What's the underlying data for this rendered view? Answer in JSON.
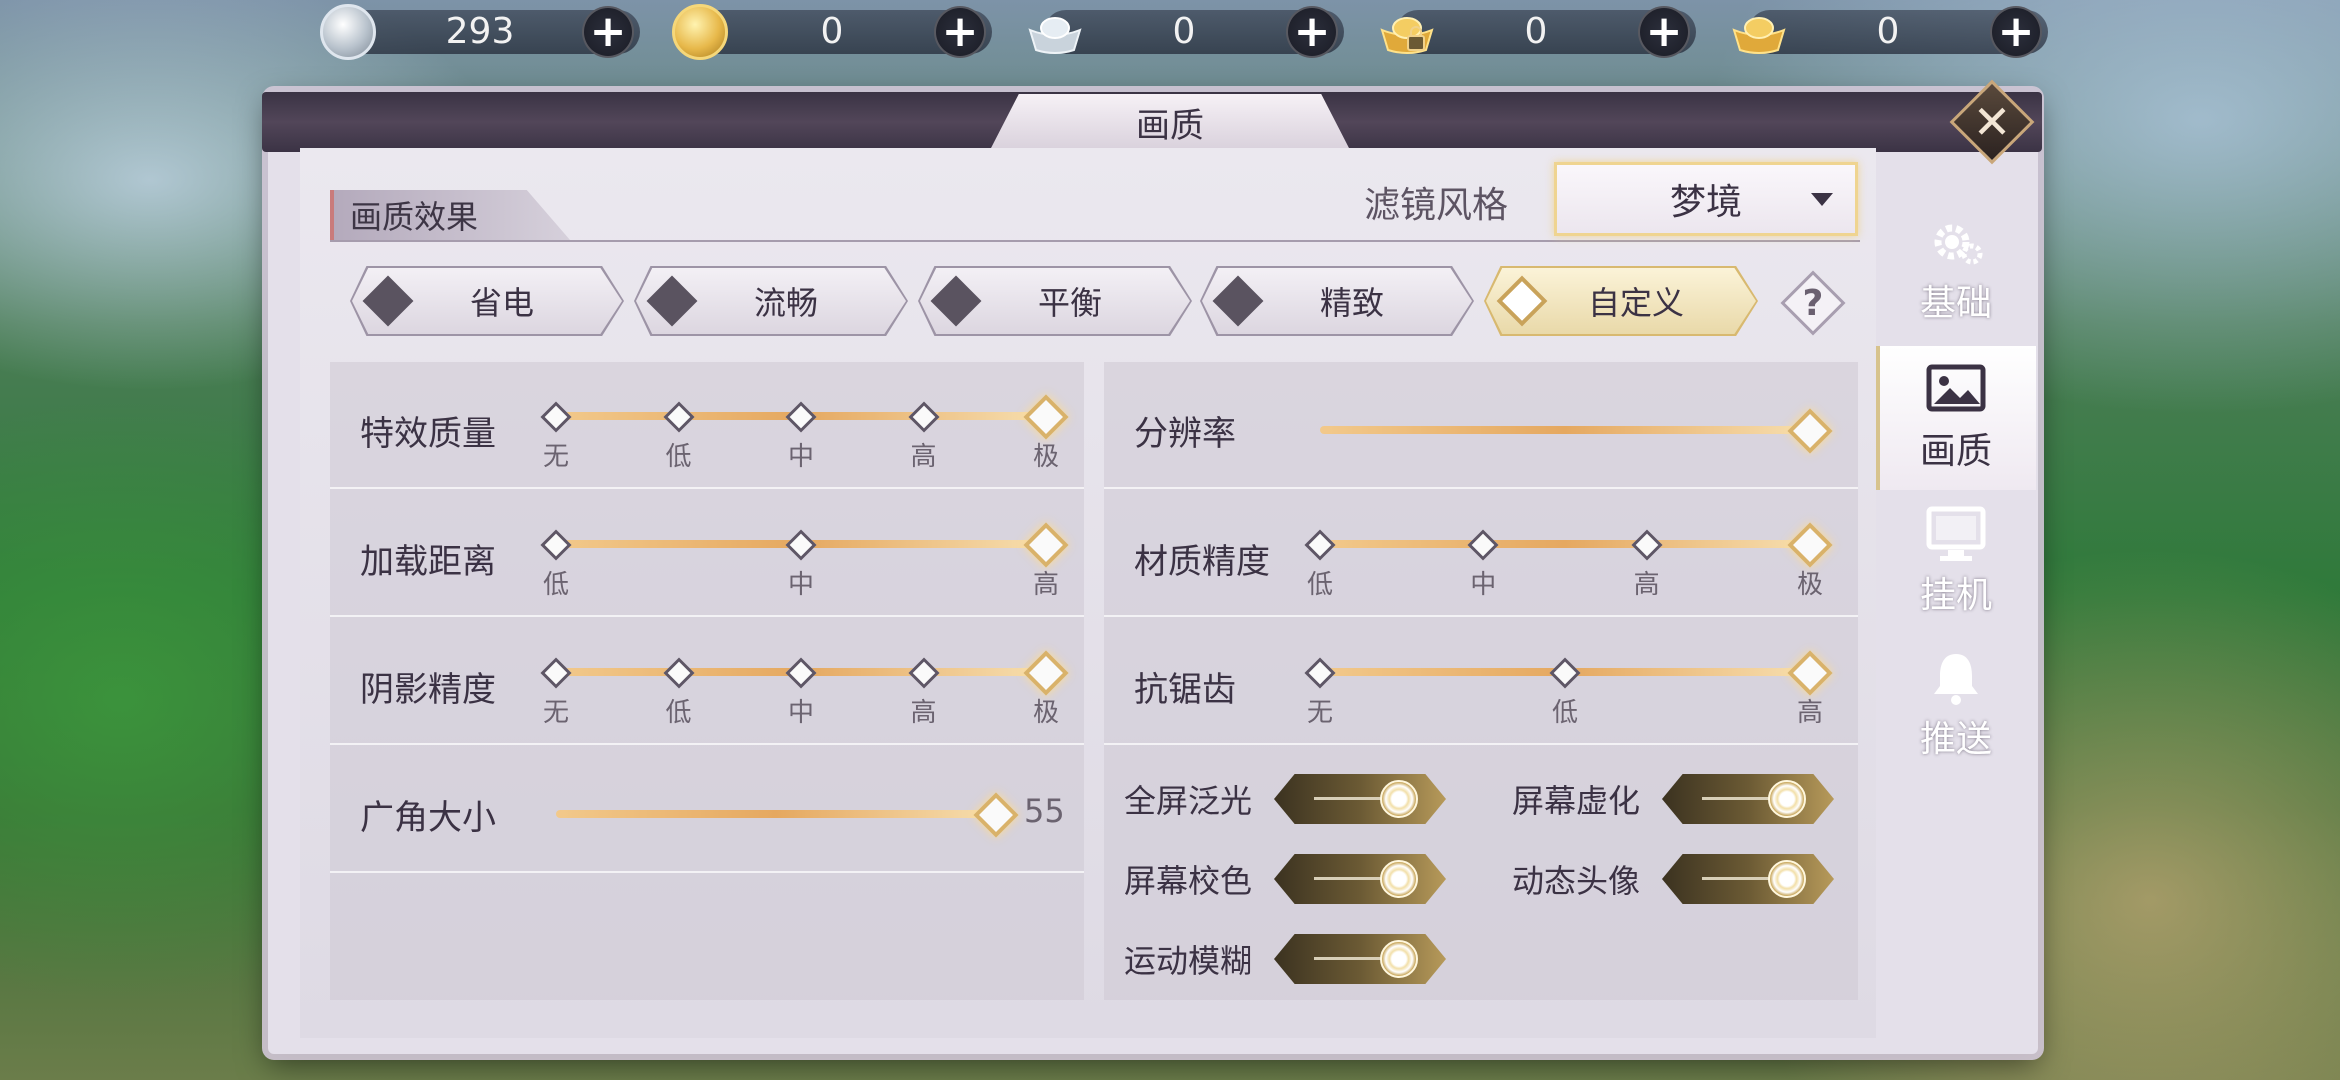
{
  "currencies": [
    {
      "icon": "silver-coin-icon",
      "value": "293"
    },
    {
      "icon": "gold-coin-icon",
      "value": "0"
    },
    {
      "icon": "silver-ingot-icon",
      "value": "0"
    },
    {
      "icon": "locked-gold-ingot-icon",
      "value": "0"
    },
    {
      "icon": "gold-ingot-icon",
      "value": "0"
    }
  ],
  "window": {
    "title": "画质"
  },
  "section": {
    "title": "画质效果"
  },
  "filter": {
    "label": "滤镜风格",
    "value": "梦境"
  },
  "presets": [
    {
      "label": "省电",
      "active": false
    },
    {
      "label": "流畅",
      "active": false
    },
    {
      "label": "平衡",
      "active": false
    },
    {
      "label": "精致",
      "active": false
    },
    {
      "label": "自定义",
      "active": true
    }
  ],
  "help": {
    "label": "?"
  },
  "left_settings": [
    {
      "label": "特效质量",
      "ticks": [
        "无",
        "低",
        "中",
        "高",
        "极"
      ],
      "selected": 4
    },
    {
      "label": "加载距离",
      "ticks": [
        "低",
        "中",
        "高"
      ],
      "selected": 2
    },
    {
      "label": "阴影精度",
      "ticks": [
        "无",
        "低",
        "中",
        "高",
        "极"
      ],
      "selected": 4
    }
  ],
  "fov": {
    "label": "广角大小",
    "value": "55",
    "fraction": 0.92
  },
  "right_settings": [
    {
      "label": "分辨率",
      "ticks": [],
      "fraction": 1.0
    },
    {
      "label": "材质精度",
      "ticks": [
        "低",
        "中",
        "高",
        "极"
      ],
      "selected": 3
    },
    {
      "label": "抗锯齿",
      "ticks": [
        "无",
        "低",
        "高"
      ],
      "selected": 2
    }
  ],
  "toggles": [
    {
      "label": "全屏泛光",
      "on": true
    },
    {
      "label": "屏幕虚化",
      "on": true
    },
    {
      "label": "屏幕校色",
      "on": true
    },
    {
      "label": "动态头像",
      "on": true
    },
    {
      "label": "运动模糊",
      "on": true
    }
  ],
  "side_tabs": [
    {
      "label": "基础",
      "icon": "gear-icon",
      "active": false
    },
    {
      "label": "画质",
      "icon": "picture-icon",
      "active": true
    },
    {
      "label": "挂机",
      "icon": "monitor-icon",
      "active": false
    },
    {
      "label": "推送",
      "icon": "bell-icon",
      "active": false
    }
  ],
  "colors": {
    "accent_gold": "#d9b26a",
    "panel_bg": "#e4e0ea",
    "text_dark": "#3b3244"
  }
}
